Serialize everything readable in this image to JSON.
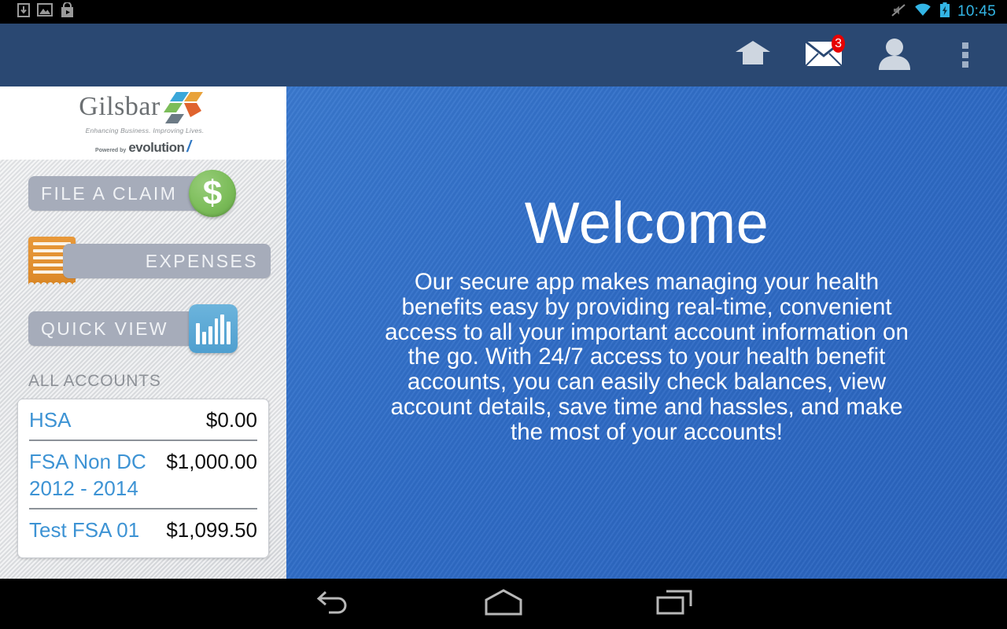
{
  "status_bar": {
    "icons": [
      "download-icon",
      "image-icon",
      "play-store-icon"
    ],
    "right_icons": [
      "mute-icon",
      "wifi-icon",
      "battery-charging-icon"
    ],
    "time": "10:45"
  },
  "app_header": {
    "actions": [
      {
        "name": "home-icon",
        "label": "Home"
      },
      {
        "name": "messages-icon",
        "label": "Messages",
        "badge": "3"
      },
      {
        "name": "profile-icon",
        "label": "Profile"
      },
      {
        "name": "overflow-menu-icon",
        "label": "More options"
      }
    ]
  },
  "sidebar": {
    "logo": {
      "brand": "Gilsbar",
      "tagline": "Enhancing Business. Improving Lives.",
      "powered_by": "Powered by",
      "powered_brand": "evolution"
    },
    "nav": [
      {
        "label": "FILE A CLAIM",
        "icon": "dollar-coin-icon",
        "glyph": "$"
      },
      {
        "label": "EXPENSES",
        "icon": "receipt-icon"
      },
      {
        "label": "QUICK VIEW",
        "icon": "bar-chart-icon"
      }
    ],
    "accounts_label": "ALL ACCOUNTS",
    "accounts": [
      {
        "name": "HSA",
        "balance": "$0.00"
      },
      {
        "name": "FSA Non DC 2012 - 2014",
        "balance": "$1,000.00"
      },
      {
        "name": "Test FSA 01",
        "balance": "$1,099.50"
      }
    ]
  },
  "main": {
    "title": "Welcome",
    "body": "Our secure app makes managing your health benefits easy by providing real-time, convenient access to all your important account information on the go. With 24/7 access to your health benefit accounts, you can easily check balances, view account details, save time and hassles, and make the most of your accounts!"
  },
  "nav_bar": {
    "buttons": [
      {
        "name": "back-button",
        "label": "Back"
      },
      {
        "name": "home-button",
        "label": "Home"
      },
      {
        "name": "recent-apps-button",
        "label": "Recent apps"
      }
    ]
  },
  "colors": {
    "header_navy": "#2a4872",
    "main_blue": "#2f6cc6",
    "accent_link": "#3d93d4",
    "badge_red": "#e60000",
    "coin_green": "#7cbd5a",
    "receipt_orange": "#dd8a2b",
    "chart_blue": "#4f9fcf",
    "status_cyan": "#33b5e5"
  }
}
